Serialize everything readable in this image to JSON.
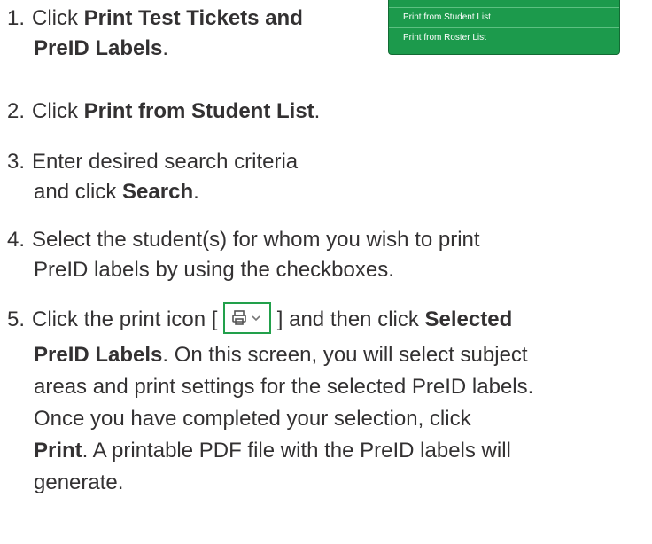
{
  "menu": {
    "items": [
      "Print from Student List",
      "Print from Roster List"
    ]
  },
  "steps": [
    {
      "n": "1.",
      "pre": "Click ",
      "bold": "Print Test Tickets and",
      "line2bold": "PreID Labels",
      "line2post": "."
    },
    {
      "n": "2.",
      "pre": "Click ",
      "bold": "Print from Student List",
      "post": "."
    },
    {
      "n": "3.",
      "line1": "Enter desired search criteria",
      "line2pre": "and click ",
      "line2bold": "Search",
      "line2post": "."
    },
    {
      "n": "4.",
      "line1": "Select the student(s) for whom you wish to print",
      "line2": "PreID labels by using the checkboxes."
    },
    {
      "n": "5.",
      "pre": "Click the print icon [",
      "mid": "] and then click ",
      "bold": "Selected",
      "line2bold": "PreID Labels",
      "line2post": ". On this screen, you will select subject",
      "line3": "areas and print settings for the selected PreID labels.",
      "line4": "Once you have completed your selection, click",
      "line5bold": "Print",
      "line5post": ". A printable PDF file with the PreID labels will",
      "line6": "generate."
    }
  ],
  "icons": {
    "print": "printer-icon",
    "chevron": "chevron-down-icon"
  },
  "colors": {
    "accent": "#1c9a4c",
    "text": "#333132"
  }
}
